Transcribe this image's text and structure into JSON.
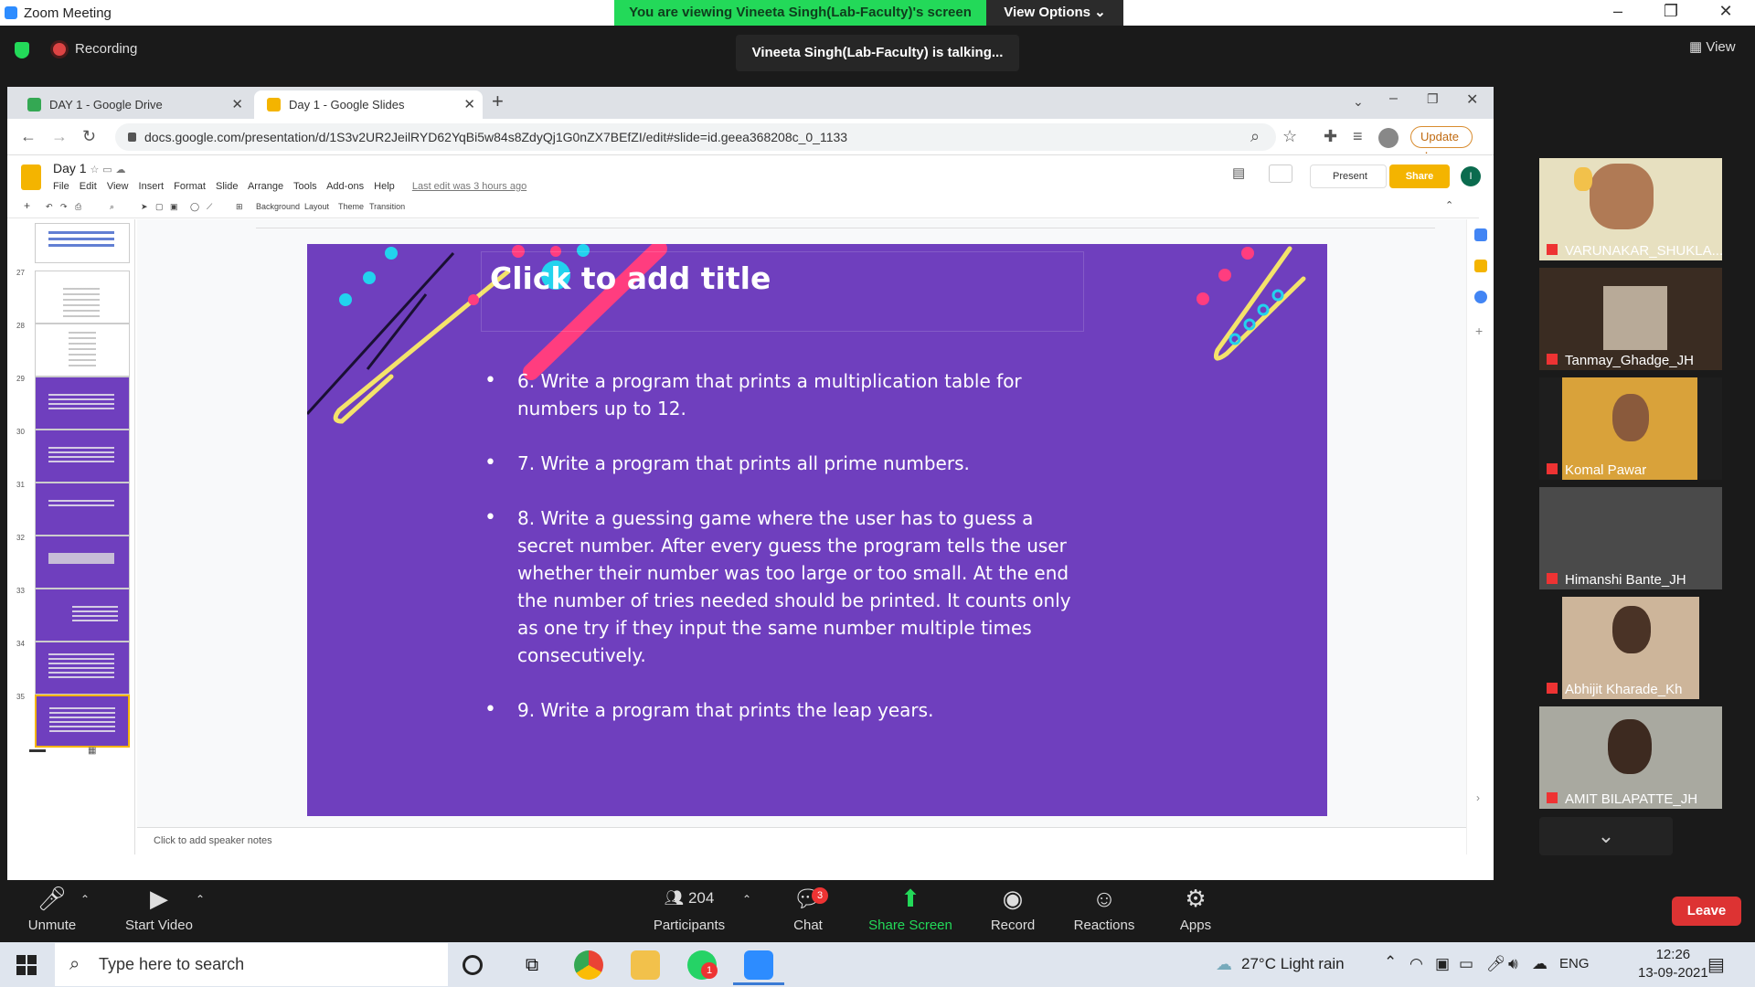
{
  "zoom": {
    "window_title": "Zoom Meeting",
    "viewing_banner": "You are viewing Vineeta Singh(Lab-Faculty)'s screen",
    "view_options": "View Options",
    "recording_label": "Recording",
    "talking": "Vineeta Singh(Lab-Faculty) is talking...",
    "view_label": "View"
  },
  "browser": {
    "tabs": [
      {
        "label": "DAY 1 - Google Drive",
        "favicon_color": "#34a853"
      },
      {
        "label": "Day 1 - Google Slides",
        "favicon_color": "#f4b400"
      }
    ],
    "url": "docs.google.com/presentation/d/1S3v2UR2JeilRYD62YqBi5w84s8ZdyQj1G0nZX7BEfZI/edit#slide=id.geea368208c_0_1133",
    "update_label": "Update"
  },
  "slides": {
    "doc_title": "Day 1",
    "menu": [
      "File",
      "Edit",
      "View",
      "Insert",
      "Format",
      "Slide",
      "Arrange",
      "Tools",
      "Add-ons",
      "Help"
    ],
    "last_edit": "Last edit was 3 hours ago",
    "present_label": "Present",
    "share_label": "Share",
    "avatar_letter": "I",
    "toolbar": {
      "background": "Background",
      "layout": "Layout",
      "theme": "Theme",
      "transition": "Transition"
    },
    "thumb_numbers": [
      "27",
      "28",
      "29",
      "30",
      "31",
      "32",
      "33",
      "34",
      "35"
    ],
    "slide": {
      "title": "Click to add title",
      "bullets": [
        "6. Write a program that prints a multiplication table for numbers up to 12.",
        "7. Write a program that prints all prime numbers.",
        "8. Write a guessing game where the user has to guess a secret number. After every guess the program tells the user whether their number was too large or too small. At the end the number of tries needed should be printed. It counts only as one try if they input the same number multiple times consecutively.",
        "9. Write a program that prints the leap years."
      ]
    },
    "speaker_notes": "Click to add speaker notes"
  },
  "participants": [
    {
      "name": "VARUNAKAR_SHUKLA..."
    },
    {
      "name": "Tanmay_Ghadge_JH"
    },
    {
      "name": "Komal Pawar"
    },
    {
      "name": "Himanshi Bante_JH"
    },
    {
      "name": "Abhijit Kharade_Kh"
    },
    {
      "name": "AMIT BILAPATTE_JH"
    }
  ],
  "controls": {
    "unmute": "Unmute",
    "start_video": "Start Video",
    "participants_count": "204",
    "participants": "Participants",
    "chat": "Chat",
    "chat_badge": "3",
    "share_screen": "Share Screen",
    "record": "Record",
    "reactions": "Reactions",
    "apps": "Apps",
    "leave": "Leave"
  },
  "taskbar": {
    "search_placeholder": "Type here to search",
    "weather": "27°C  Light rain",
    "lang": "ENG",
    "time": "12:26",
    "date": "13-09-2021",
    "whatsapp_badge": "1"
  },
  "colors": {
    "slide_bg": "#6f3fbe",
    "accent_pink": "#ff3d7f",
    "accent_cyan": "#22d3ee",
    "accent_yellow": "#f4e36b",
    "zoom_green": "#23d959",
    "leave_red": "#d33333"
  }
}
